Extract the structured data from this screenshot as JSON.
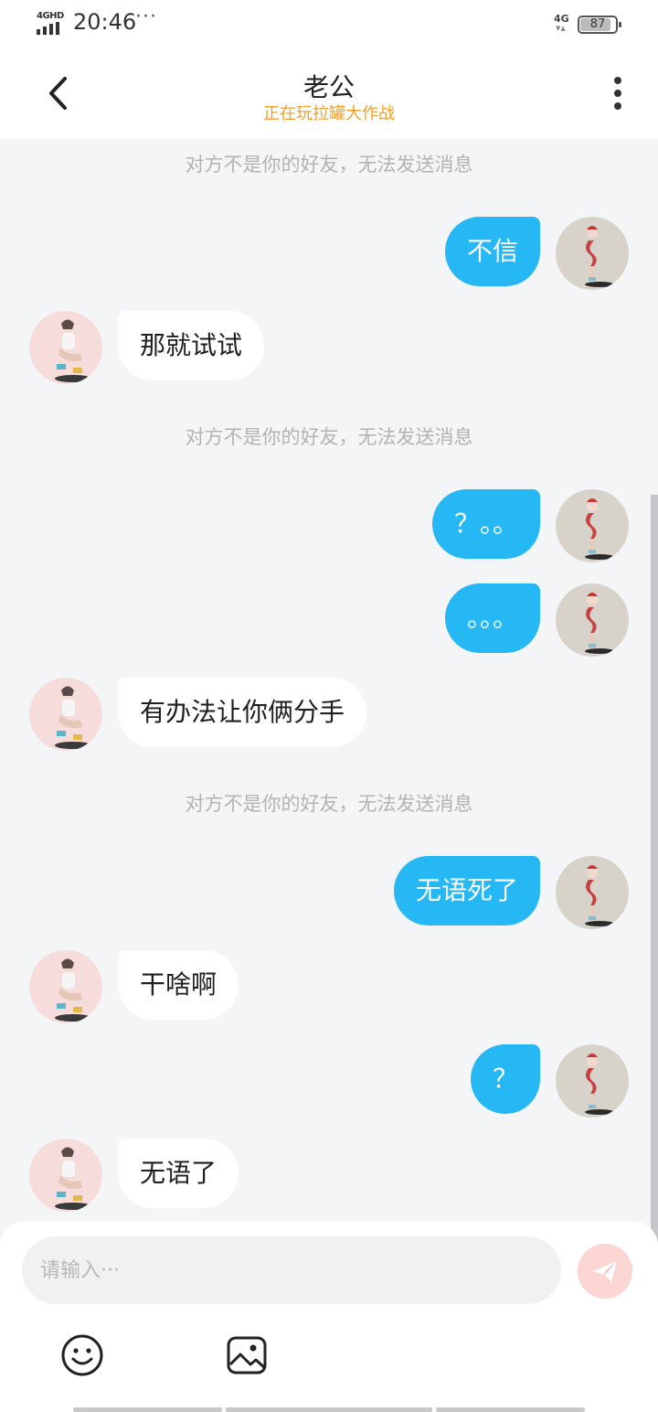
{
  "status_bar": {
    "network": "4GHD",
    "time": "20:46",
    "more": "···",
    "mobile_data": "4G",
    "data_arrows": "▼▲",
    "battery": "87",
    "battery_level": 0.87
  },
  "header": {
    "back_icon": "chevron-left-icon",
    "title": "老公",
    "subtitle": "正在玩拉罐大作战",
    "more_icon": "more-vertical-icon"
  },
  "chat": {
    "system_notice": "对方不是你的好友，无法发送消息",
    "messages": [
      {
        "kind": "system",
        "text": "对方不是你的好友，无法发送消息"
      },
      {
        "kind": "me",
        "text": "不信"
      },
      {
        "kind": "peer",
        "text": "那就试试"
      },
      {
        "kind": "system",
        "text": "对方不是你的好友，无法发送消息"
      },
      {
        "kind": "me",
        "text": "？。。"
      },
      {
        "kind": "me",
        "text": "。。。"
      },
      {
        "kind": "peer",
        "text": "有办法让你俩分手"
      },
      {
        "kind": "system",
        "text": "对方不是你的好友，无法发送消息"
      },
      {
        "kind": "me",
        "text": "无语死了"
      },
      {
        "kind": "peer",
        "text": "干啥啊"
      },
      {
        "kind": "me",
        "text": "？"
      },
      {
        "kind": "peer",
        "text": "无语了"
      }
    ]
  },
  "composer": {
    "placeholder": "请输入···",
    "value": "",
    "send_icon": "paper-plane-icon",
    "emoji_icon": "smiley-icon",
    "image_icon": "image-icon"
  },
  "colors": {
    "my_bubble": "#26b7f5",
    "peer_bubble": "#ffffff",
    "subtitle": "#f2a02a",
    "background": "#f4f5f7",
    "send_button": "#fbd6d2"
  }
}
